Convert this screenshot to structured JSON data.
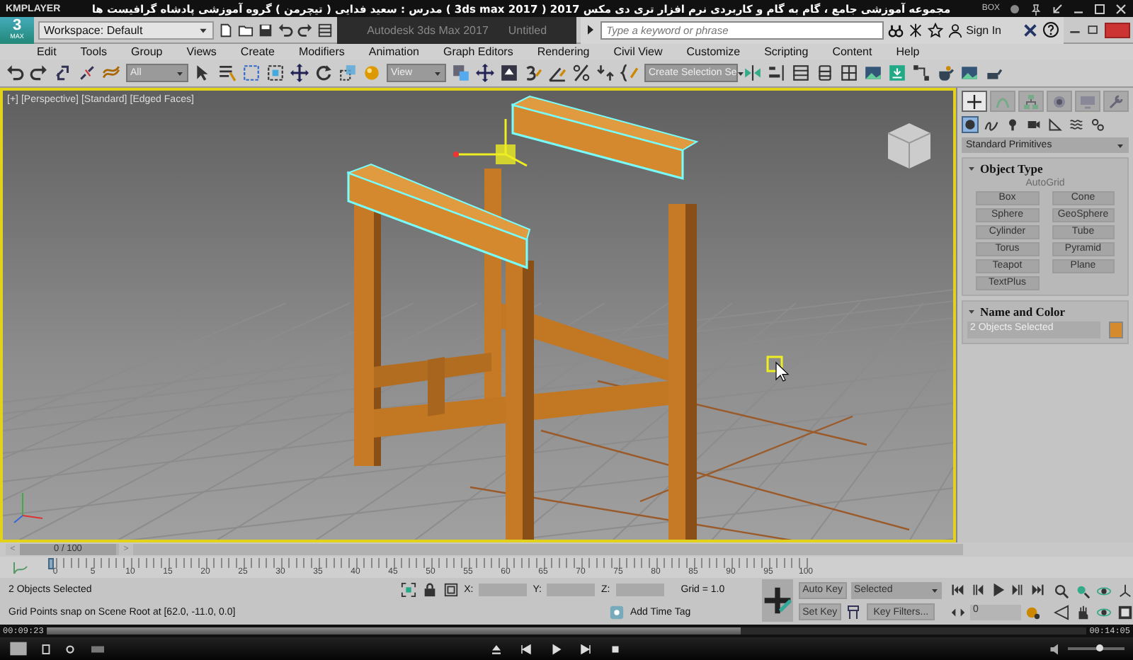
{
  "player": {
    "app_name": "KMPLAYER",
    "title": "مجموعه آموزشی جامع ، گام به گام و کاربردی نرم افزار تری دی مکس 2017 ( 3ds max 2017 )  مدرس : سعید فدایی ( تیچرمن ) گروه آموزشی پادشاه گرافیست ها",
    "box_label": "BOX",
    "elapsed": "00:09:23",
    "total": "00:14:05",
    "progress": {
      "level": 0.667
    },
    "volume": {
      "level": 0.55
    }
  },
  "max": {
    "logo": "3",
    "logo_sub": "MAX",
    "workspace": "Workspace: Default",
    "title": "Autodesk 3ds Max 2017",
    "document": "Untitled",
    "search_placeholder": "Type a keyword or phrase",
    "sign_in": "Sign In"
  },
  "menu": [
    "Edit",
    "Tools",
    "Group",
    "Views",
    "Create",
    "Modifiers",
    "Animation",
    "Graph Editors",
    "Rendering",
    "Civil View",
    "Customize",
    "Scripting",
    "Content",
    "Help"
  ],
  "toolbar": {
    "selection_filter": "All",
    "reference_coord": "View",
    "named_selection": "Create Selection Se"
  },
  "viewport": {
    "labels": [
      "[+]",
      "[Perspective]",
      "[Standard]",
      "[Edged Faces]"
    ]
  },
  "command_panel": {
    "tabs": [
      {
        "kind": "create",
        "selected": true
      },
      {
        "kind": "modify",
        "selected": false
      },
      {
        "kind": "hierarchy",
        "selected": false
      },
      {
        "kind": "motion",
        "selected": false
      },
      {
        "kind": "display",
        "selected": false
      },
      {
        "kind": "utilities",
        "selected": false
      }
    ],
    "categories": [
      {
        "kind": "geometry",
        "selected": true
      },
      {
        "kind": "shapes",
        "selected": false
      },
      {
        "kind": "lights",
        "selected": false
      },
      {
        "kind": "cameras",
        "selected": false
      },
      {
        "kind": "helpers",
        "selected": false
      },
      {
        "kind": "spacewarps",
        "selected": false
      },
      {
        "kind": "systems",
        "selected": false
      }
    ],
    "subcategory": "Standard Primitives",
    "object_type": {
      "title": "Object Type",
      "autogrid": "AutoGrid",
      "autogrid_disabled": true,
      "buttons": [
        "Box",
        "Cone",
        "Sphere",
        "GeoSphere",
        "Cylinder",
        "Tube",
        "Torus",
        "Pyramid",
        "Teapot",
        "Plane",
        "TextPlus"
      ]
    },
    "name_and_color": {
      "title": "Name and Color",
      "name": "2 Objects Selected",
      "color": "#d68a2e"
    }
  },
  "time_slider": {
    "prev": "<",
    "position": "0 / 100",
    "next": ">"
  },
  "track": {
    "ticks": [
      "0",
      "5",
      "10",
      "15",
      "20",
      "25",
      "30",
      "35",
      "40",
      "45",
      "50",
      "55",
      "60",
      "65",
      "70",
      "75",
      "80",
      "85",
      "90",
      "95",
      "100"
    ]
  },
  "status": {
    "selection": "2 Objects Selected",
    "prompt": "Grid Points snap on Scene Root at [62.0, -11.0, 0.0]",
    "x_label": "X:",
    "y_label": "Y:",
    "z_label": "Z:",
    "grid": "Grid = 1.0",
    "time_tag": "Add Time Tag",
    "auto_key": "Auto Key",
    "key_mode": "Selected",
    "set_key": "Set Key",
    "key_filters": "Key Filters...",
    "frame": "0"
  }
}
